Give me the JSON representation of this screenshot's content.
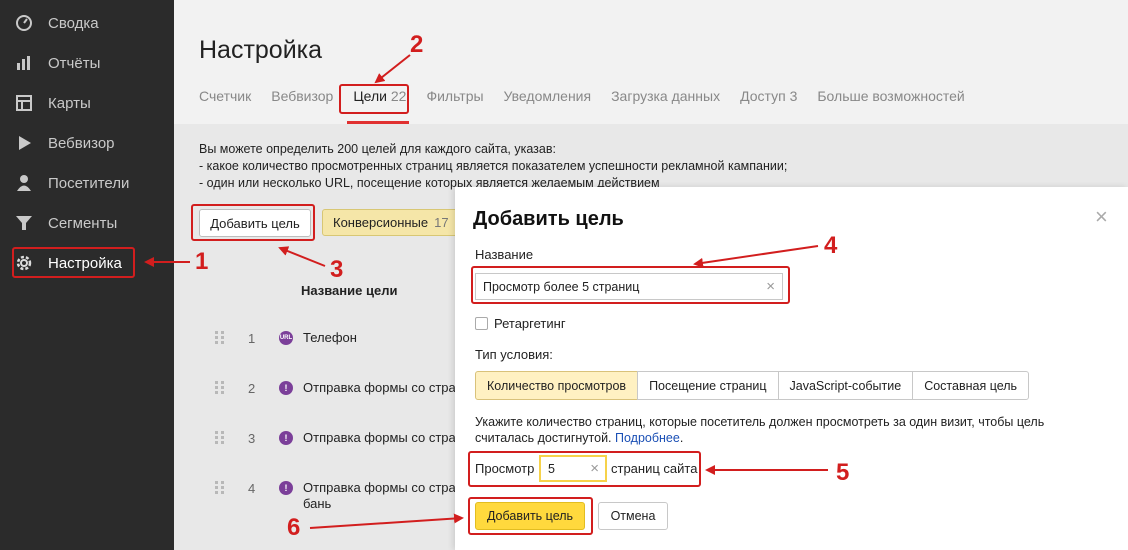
{
  "sidebar": {
    "items": [
      {
        "label": "Сводка",
        "icon": "gauge-icon"
      },
      {
        "label": "Отчёты",
        "icon": "bar-chart-icon"
      },
      {
        "label": "Карты",
        "icon": "map-icon"
      },
      {
        "label": "Вебвизор",
        "icon": "play-icon"
      },
      {
        "label": "Посетители",
        "icon": "user-icon"
      },
      {
        "label": "Сегменты",
        "icon": "filter-icon"
      },
      {
        "label": "Настройка",
        "icon": "gear-icon"
      }
    ]
  },
  "header": {
    "title": "Настройка"
  },
  "tabs": [
    {
      "label": "Счетчик",
      "count": ""
    },
    {
      "label": "Вебвизор",
      "count": ""
    },
    {
      "label": "Цели",
      "count": "22"
    },
    {
      "label": "Фильтры",
      "count": ""
    },
    {
      "label": "Уведомления",
      "count": ""
    },
    {
      "label": "Загрузка данных",
      "count": ""
    },
    {
      "label": "Доступ",
      "count": "3"
    },
    {
      "label": "Больше возможностей",
      "count": ""
    }
  ],
  "intro": {
    "line1": "Вы можете определить 200 целей для каждого сайта, указав:",
    "line2": "-  какое количество просмотренных страниц является показателем успешности рекламной кампании;",
    "line3": "-  один или несколько URL, посещение которых является желаемым действием"
  },
  "goals_page": {
    "add_button": "Добавить цель",
    "conversion_chip": {
      "label": "Конверсионные",
      "count": "17"
    },
    "column_header": "Название цели",
    "rows": [
      {
        "num": "1",
        "icon": "url-icon",
        "icon_text": "URL",
        "name": "Телефон",
        "name2": ""
      },
      {
        "num": "2",
        "icon": "exclamation-icon",
        "icon_text": "!",
        "name": "Отправка формы со страни",
        "name2": ""
      },
      {
        "num": "3",
        "icon": "exclamation-icon",
        "icon_text": "!",
        "name": "Отправка формы со страни",
        "name2": ""
      },
      {
        "num": "4",
        "icon": "exclamation-icon",
        "icon_text": "!",
        "name": "Отправка формы со страни",
        "name2": "бань"
      }
    ]
  },
  "modal": {
    "title": "Добавить цель",
    "close": "×",
    "name_label": "Название",
    "name_value": "Просмотр более 5 страниц",
    "clear": "×",
    "retargeting_label": "Ретаргетинг",
    "retargeting_checked": false,
    "condition_label": "Тип условия:",
    "condition_options": [
      "Количество просмотров",
      "Посещение страниц",
      "JavaScript-событие",
      "Составная цель"
    ],
    "condition_selected": "Количество просмотров",
    "hint_text": "Укажите количество страниц, которые посетитель должен просмотреть за один визит, чтобы цель считалась достигнутой.",
    "hint_link": "Подробнее",
    "hint_end": ".",
    "views_prefix": "Просмотр",
    "views_value": "5",
    "views_suffix": "страниц сайта",
    "submit_label": "Добавить цель",
    "cancel_label": "Отмена"
  },
  "annotations": {
    "color": "#d21e1e",
    "labels": [
      "1",
      "2",
      "3",
      "4",
      "5",
      "6"
    ]
  },
  "colors": {
    "sidebar_bg": "#2b2b2b",
    "accent_yellow": "#ffd93d",
    "active_option_bg": "#fff1c2",
    "link": "#1a4fb5"
  }
}
